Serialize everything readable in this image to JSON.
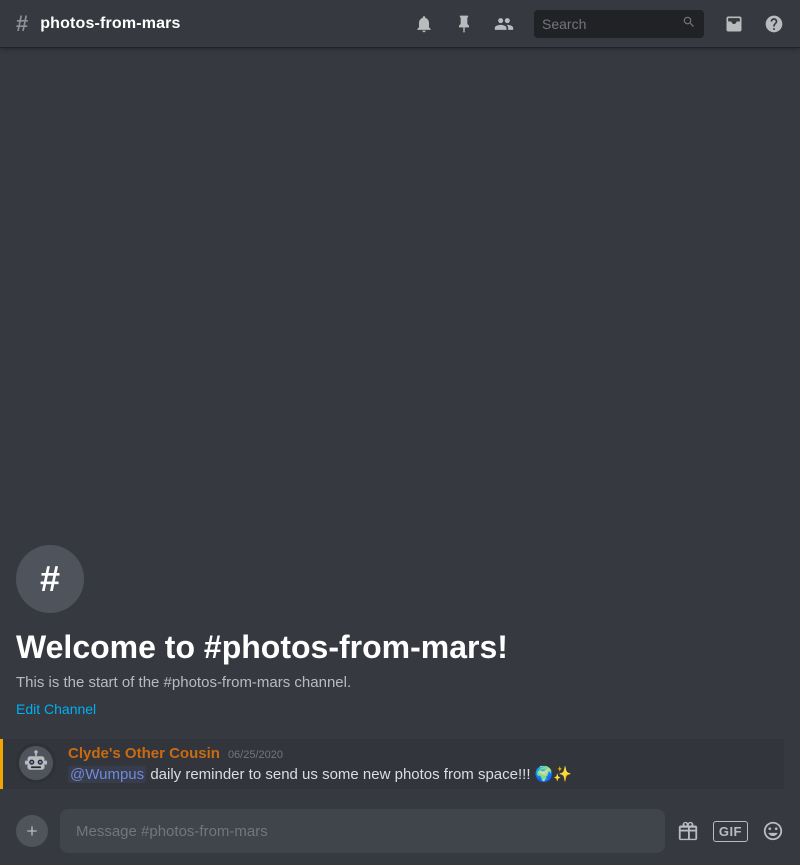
{
  "topbar": {
    "channel_icon": "#",
    "channel_name": "photos-from-mars",
    "search_placeholder": "Search"
  },
  "channel_intro": {
    "hash_icon": "#",
    "welcome_title": "Welcome to #photos-from-mars!",
    "welcome_desc": "This is the start of the #photos-from-mars channel.",
    "edit_channel_label": "Edit Channel"
  },
  "messages": [
    {
      "author": "Clyde's Other Cousin",
      "timestamp": "06/25/2020",
      "mention": "@Wumpus",
      "text": " daily reminder to send us some new photos from space!!! 🌍✨"
    }
  ],
  "input": {
    "placeholder": "Message #photos-from-mars"
  },
  "icons": {
    "bell": "🔔",
    "pin": "📌",
    "people": "👤",
    "search": "🔍",
    "inbox": "💬",
    "help": "❓",
    "add": "+",
    "gift": "🎁",
    "emoji": "😊"
  }
}
